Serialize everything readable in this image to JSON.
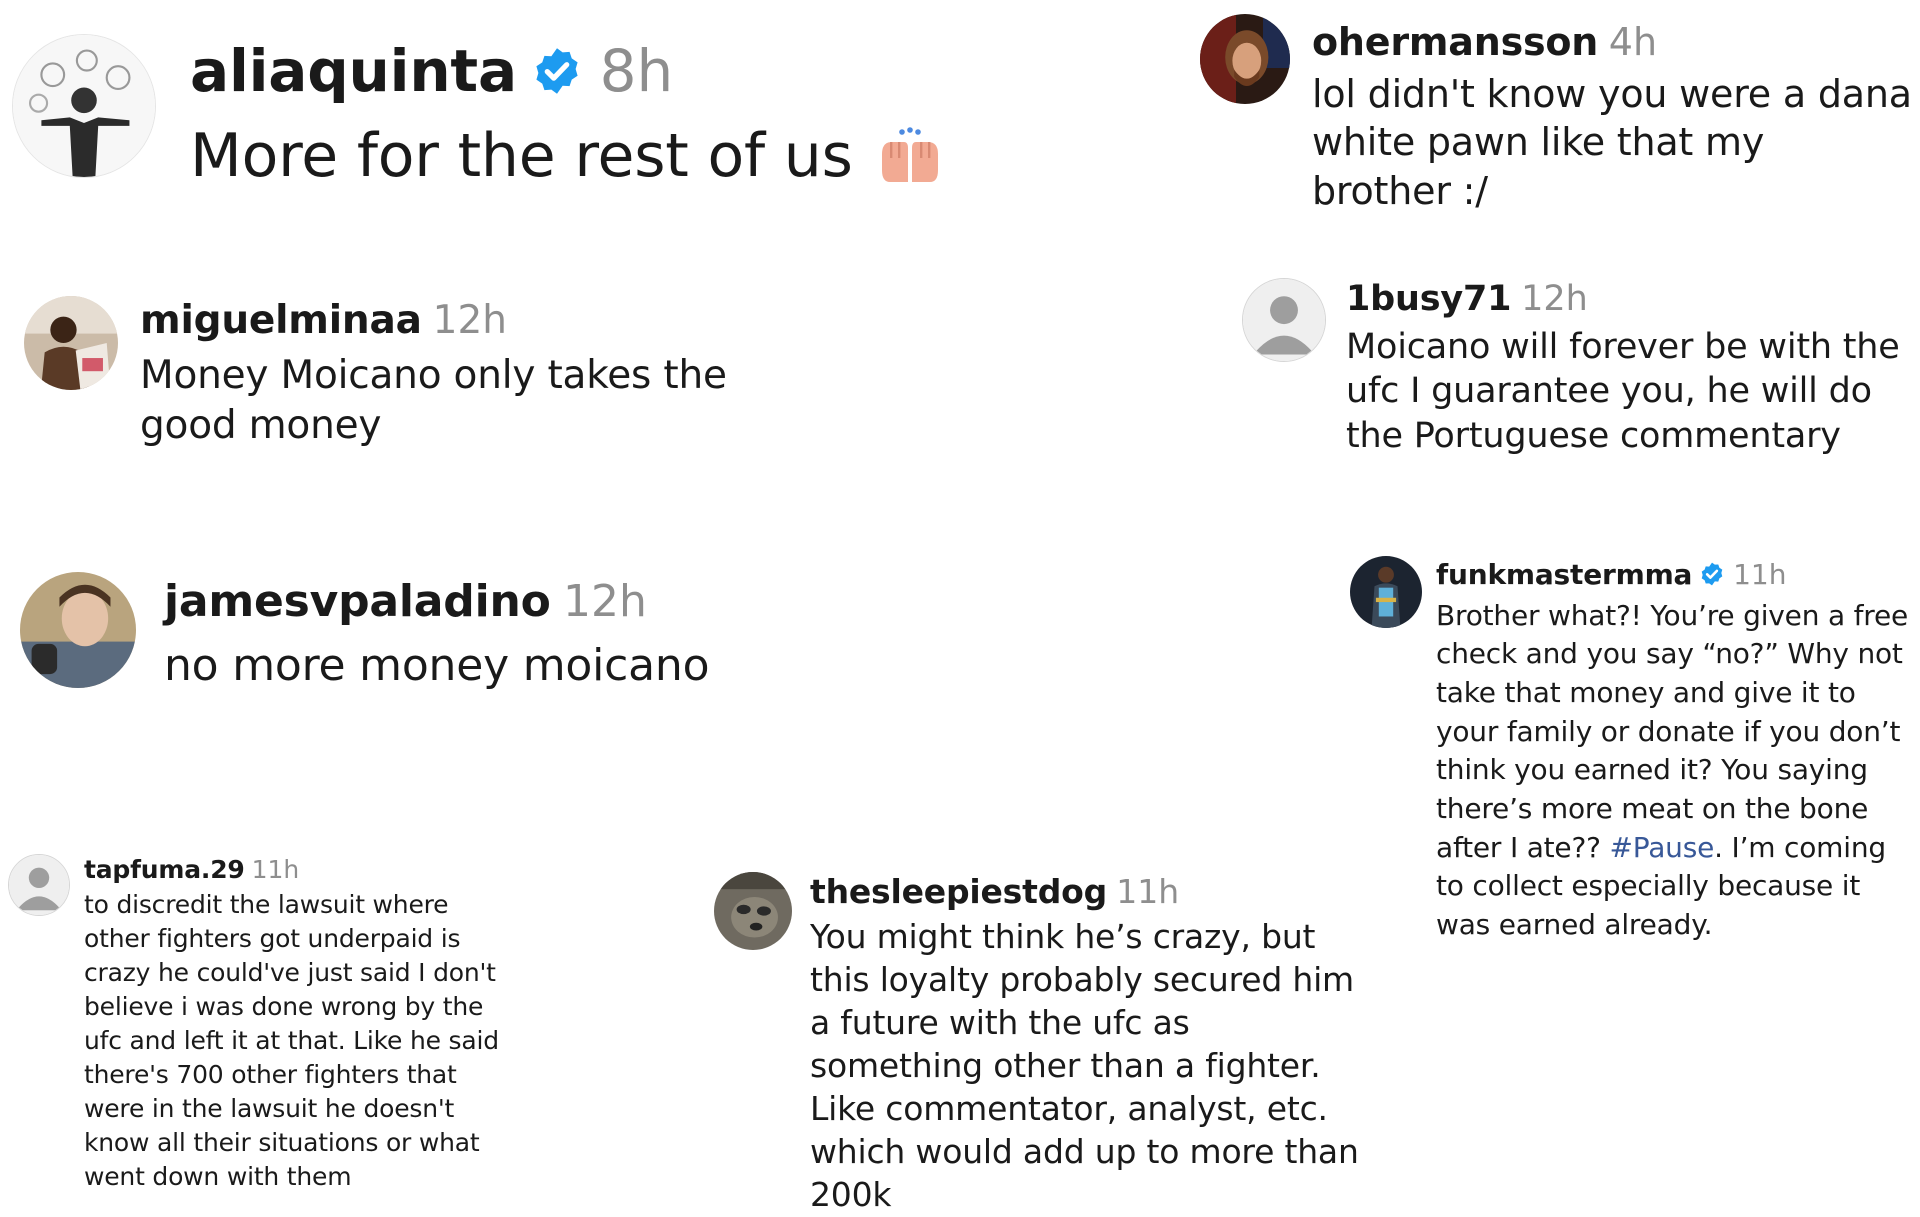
{
  "comments": [
    {
      "username": "aliaquinta",
      "time": "8h",
      "verified": true,
      "text": "More for the rest of us",
      "emoji_icon": "raised-hands-icon"
    },
    {
      "username": "ohermansson",
      "time": "4h",
      "verified": false,
      "text": "lol didn't know you were a dana white pawn like that my brother :/"
    },
    {
      "username": "miguelminaa",
      "time": "12h",
      "verified": false,
      "text": "Money Moicano only takes the good money"
    },
    {
      "username": "1busy71",
      "time": "12h",
      "verified": false,
      "text": "Moicano will forever be with the ufc I guarantee you, he will do the Portuguese commentary"
    },
    {
      "username": "jamesvpaladino",
      "time": "12h",
      "verified": false,
      "text": "no more money moicano"
    },
    {
      "username": "funkmastermma",
      "time": "11h",
      "verified": true,
      "text_before": "Brother what?! You’re given a free check and you say “no?” Why not take that money and give it to your family or donate if you don’t think you earned it? You saying there’s more meat on the bone after I ate??",
      "hashtag": "#Pause",
      "text_after": ". I’m coming to collect especially because it was earned already."
    },
    {
      "username": "tapfuma.29",
      "time": "11h",
      "verified": false,
      "text": "to discredit the lawsuit where other fighters got underpaid is crazy he could've just said I don't believe i was done wrong by the ufc and left it at that. Like he said there's 700 other fighters that were in the lawsuit he doesn't know all their situations or what went down with them"
    },
    {
      "username": "thesleepiestdog",
      "time": "11h",
      "verified": false,
      "text": "You might think he’s crazy, but this loyalty probably secured him a future with the ufc as something other than a fighter. Like commentator, analyst, etc. which would add up to more than 200k"
    }
  ],
  "colors": {
    "verified": "#1d9bf0",
    "hashtag": "#385898",
    "timestamp": "#8e8e8e"
  }
}
